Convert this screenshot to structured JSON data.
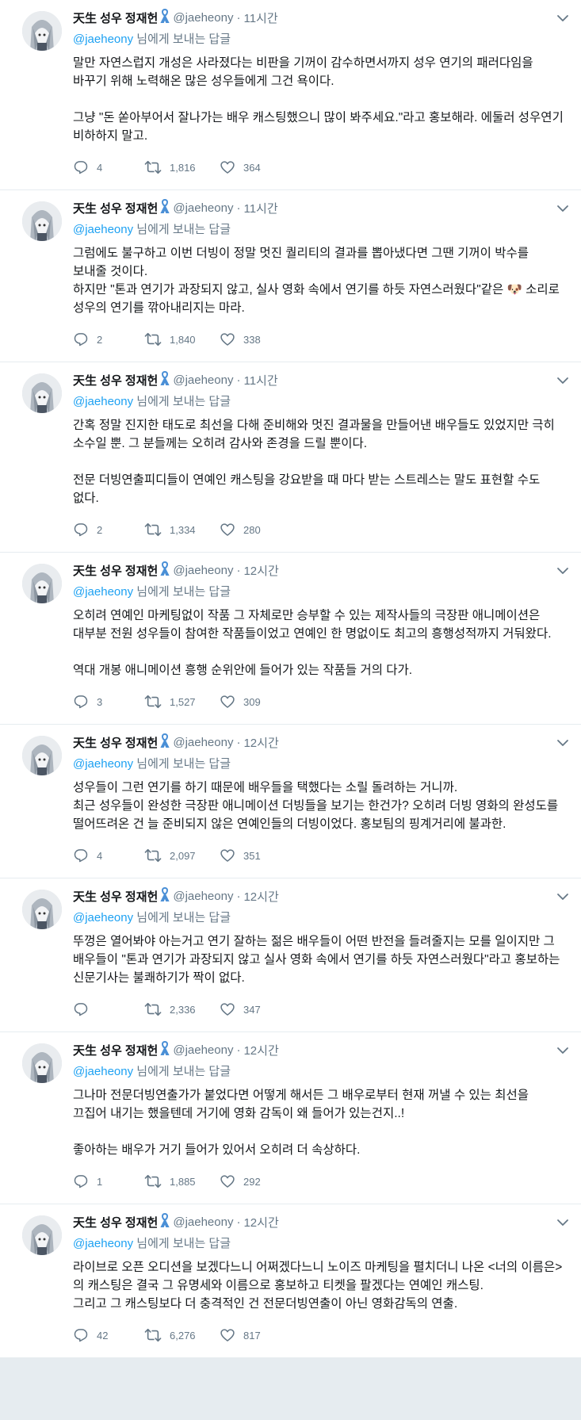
{
  "user": {
    "name": "天生 성우 정재헌",
    "handle": "@jaeheony"
  },
  "reply_prefix": "@jaeheony",
  "reply_suffix": " 님에게 보내는 답글",
  "colors": {
    "accent": "#1da1f2",
    "muted": "#657786",
    "ribbon": "#4a8fd6"
  },
  "tweets": [
    {
      "time": "11시간",
      "text": "말만 자연스럽지 개성은 사라졌다는 비판을 기꺼이 감수하면서까지 성우 연기의 패러다임을 바꾸기 위해 노력해온 많은 성우들에게 그건 욕이다.\n\n그냥 \"돈 쏟아부어서 잘나가는 배우 캐스팅했으니 많이 봐주세요.\"라고 홍보해라. 에둘러 성우연기 비하하지 말고.",
      "replies": "4",
      "retweets": "1,816",
      "likes": "364"
    },
    {
      "time": "11시간",
      "text": "그럼에도 불구하고 이번 더빙이 정말 멋진 퀄리티의 결과를 뽑아냈다면 그땐 기꺼이 박수를 보내줄 것이다.\n하지만 \"톤과 연기가 과장되지 않고, 실사 영화 속에서 연기를 하듯 자연스러웠다\"같은 🐶 소리로 성우의 연기를 깎아내리지는 마라.",
      "replies": "2",
      "retweets": "1,840",
      "likes": "338"
    },
    {
      "time": "11시간",
      "text": "간혹 정말 진지한 태도로 최선을 다해 준비해와 멋진 결과물을 만들어낸 배우들도 있었지만 극히 소수일 뿐. 그 분들께는 오히려 감사와 존경을 드릴 뿐이다.\n\n전문 더빙연출피디들이 연예인 캐스팅을 강요받을 때 마다 받는 스트레스는 말도 표현할 수도 없다.",
      "replies": "2",
      "retweets": "1,334",
      "likes": "280"
    },
    {
      "time": "12시간",
      "text": "오히려 연예인 마케팅없이 작품 그 자체로만 승부할 수 있는 제작사들의 극장판 애니메이션은 대부분 전원 성우들이 참여한 작품들이었고 연예인 한 명없이도 최고의 흥행성적까지 거둬왔다.\n\n역대 개봉 애니메이션 흥행 순위안에 들어가 있는 작품들 거의 다가.",
      "replies": "3",
      "retweets": "1,527",
      "likes": "309"
    },
    {
      "time": "12시간",
      "text": "성우들이 그런 연기를 하기 때문에 배우들을 택했다는 소릴 돌려하는 거니까.\n최근 성우들이 완성한 극장판 애니메이션 더빙들을 보기는 한건가? 오히려 더빙 영화의 완성도를 떨어뜨려온 건 늘 준비되지 않은 연예인들의 더빙이었다. 홍보팀의 핑계거리에 불과한.",
      "replies": "4",
      "retweets": "2,097",
      "likes": "351"
    },
    {
      "time": "12시간",
      "text": "뚜껑은 열어봐야 아는거고 연기 잘하는 젊은 배우들이 어떤 반전을 들려줄지는 모를 일이지만 그 배우들이 \"톤과 연기가 과장되지 않고 실사 영화 속에서 연기를 하듯 자연스러웠다\"라고 홍보하는 신문기사는 불쾌하기가 짝이 없다.",
      "replies": "",
      "retweets": "2,336",
      "likes": "347"
    },
    {
      "time": "12시간",
      "text": "그나마 전문더빙연출가가 붙었다면 어떻게 해서든 그 배우로부터 현재 꺼낼 수 있는 최선을 끄집어 내기는 했을텐데 거기에 영화 감독이 왜 들어가 있는건지..!\n\n좋아하는 배우가 거기 들어가 있어서 오히려 더 속상하다.",
      "replies": "1",
      "retweets": "1,885",
      "likes": "292"
    },
    {
      "time": "12시간",
      "text": "라이브로 오픈 오디션을 보겠다느니 어쩌겠다느니 노이즈 마케팅을 펼치더니 나온 <너의 이름은>의 캐스팅은 결국 그 유명세와 이름으로 홍보하고 티켓을 팔겠다는 연예인 캐스팅.\n그리고 그 캐스팅보다 더 충격적인 건 전문더빙연출이 아닌 영화감독의 연출.",
      "replies": "42",
      "retweets": "6,276",
      "likes": "817"
    }
  ]
}
